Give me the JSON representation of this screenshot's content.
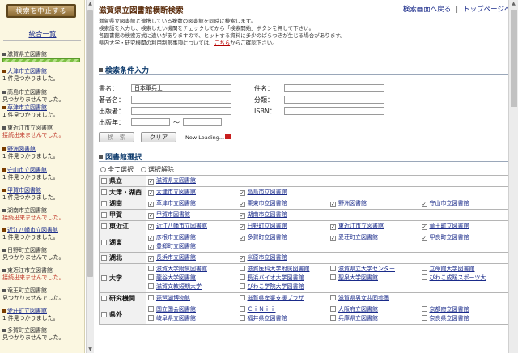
{
  "left": {
    "stop_button": "検索を中止する",
    "title": "統合一覧",
    "libraries": [
      {
        "name": "滋賀県立図書館",
        "result": "",
        "link": false
      },
      {
        "name": "大津市立図書館",
        "result": "1 件見つかりました。",
        "link": true
      },
      {
        "name": "高島市立図書館",
        "result": "見つかりませんでした。",
        "link": false
      },
      {
        "name": "草津市立図書館",
        "result": "1 件見つかりました。",
        "link": true
      },
      {
        "name": "東近江市立図書館",
        "result": "接続出来ませんでした。",
        "link": false,
        "err": true
      },
      {
        "name": "野洲図書館",
        "result": "1 件見つかりました。",
        "link": true
      },
      {
        "name": "守山市立図書館",
        "result": "1 件見つかりました。",
        "link": true
      },
      {
        "name": "甲賀市図書館",
        "result": "1 件見つかりました。",
        "link": true
      },
      {
        "name": "湖南市立図書館",
        "result": "接続出来ませんでした。",
        "link": false,
        "err": true
      },
      {
        "name": "近江八幡市立図書館",
        "result": "1 件見つかりました。",
        "link": true
      },
      {
        "name": "日野町立図書館",
        "result": "見つかりませんでした。",
        "link": false
      },
      {
        "name": "東近江市立図書館",
        "result": "接続出来ませんでした。",
        "link": false,
        "err": true
      },
      {
        "name": "竜王町立図書館",
        "result": "見つかりませんでした。",
        "link": false
      },
      {
        "name": "愛荘町立図書館",
        "result": "1 件見つかりました。",
        "link": true
      },
      {
        "name": "多賀町立図書館",
        "result": "見つかりませんでした。",
        "link": false
      }
    ]
  },
  "header": {
    "title": "滋賀県立図書館横断検索",
    "link_back": "検索画面へ戻る",
    "sep": "|",
    "link_top": "トップページへ戻"
  },
  "desc": [
    "滋賀県立図書館と連携している複数の図書館を同時に検索します。",
    "検索語を入力し、検索したい機関をチェックしてから「検索開始」ボタンを押して下さい。",
    "各図書館の検索方式に違いがありますので、ヒットする資料に多少のばらつきが生じる場合があります。"
  ],
  "desc4": {
    "before": "県内大学・研究機関の利用制限事項については、",
    "link": "こちら",
    "after": "からご確認下さい。"
  },
  "search": {
    "heading": "検索条件入力",
    "title_label": "書名：",
    "title_value": "日本軍兵士",
    "author_label": "著者名：",
    "publisher_label": "出版者：",
    "year_label": "出版年：",
    "tilde": "〜",
    "subject_label": "件名：",
    "class_label": "分類：",
    "isbn_label": "ISBN：",
    "search_btn": "検　索",
    "clear_btn": "クリア",
    "loading": "Now Loading..."
  },
  "libsel": {
    "heading": "図書館選択",
    "select_all": "全て選択",
    "deselect_all": "選択解除",
    "regions": [
      {
        "name": "県立",
        "checked": false,
        "items": [
          {
            "n": "滋賀県立図書館",
            "c": true
          }
        ]
      },
      {
        "name": "大津・湖西",
        "checked": false,
        "items": [
          {
            "n": "大津市立図書館",
            "c": true
          },
          {
            "n": "高島市立図書館",
            "c": true
          }
        ]
      },
      {
        "name": "湖南",
        "checked": false,
        "items": [
          {
            "n": "草津市立図書館",
            "c": true
          },
          {
            "n": "栗東市立図書館",
            "c": true
          },
          {
            "n": "野洲図書館",
            "c": true
          },
          {
            "n": "守山市立図書館",
            "c": true
          }
        ]
      },
      {
        "name": "甲賀",
        "checked": false,
        "items": [
          {
            "n": "甲賀市図書館",
            "c": true
          },
          {
            "n": "湖南市立図書館",
            "c": true
          }
        ]
      },
      {
        "name": "東近江",
        "checked": false,
        "items": [
          {
            "n": "近江八幡市立図書館",
            "c": true
          },
          {
            "n": "日野町立図書館",
            "c": true
          },
          {
            "n": "東近江市立図書館",
            "c": true
          },
          {
            "n": "竜王町立図書館",
            "c": true
          }
        ]
      },
      {
        "name": "湖東",
        "checked": false,
        "items": [
          {
            "n": "彦根市立図書館",
            "c": true
          },
          {
            "n": "多賀町立図書館",
            "c": true
          },
          {
            "n": "愛荘町立図書館",
            "c": true
          },
          {
            "n": "甲良町立図書館",
            "c": true
          },
          {
            "n": "豊郷町立図書館",
            "c": true
          }
        ]
      },
      {
        "name": "湖北",
        "checked": false,
        "items": [
          {
            "n": "長浜市立図書館",
            "c": true
          },
          {
            "n": "米原市立図書館",
            "c": true
          }
        ]
      },
      {
        "name": "大学",
        "checked": false,
        "items": [
          {
            "n": "滋賀大学附属図書館",
            "c": false
          },
          {
            "n": "滋賀医科大学附属図書館",
            "c": false
          },
          {
            "n": "滋賀県立大学センター",
            "c": false
          },
          {
            "n": "立命館大学図書館",
            "c": false
          },
          {
            "n": "龍谷大学図書館",
            "c": false
          },
          {
            "n": "長浜バイオ大学図書館",
            "c": false
          },
          {
            "n": "聖泉大学図書館",
            "c": false
          },
          {
            "n": "びわこ成蹊スポーツ大",
            "c": false
          },
          {
            "n": "滋賀文教短期大学",
            "c": false
          },
          {
            "n": "びわこ学院大学図書館",
            "c": false
          }
        ]
      },
      {
        "name": "研究機関",
        "checked": false,
        "items": [
          {
            "n": "琵琶湖博物館",
            "c": false
          },
          {
            "n": "滋賀県産業支援プラザ",
            "c": false
          },
          {
            "n": "滋賀県男女共同参画",
            "c": false
          }
        ]
      },
      {
        "name": "県外",
        "checked": false,
        "items": [
          {
            "n": "国立国会図書館",
            "c": false
          },
          {
            "n": "ＣｉＮｉｉ",
            "c": false
          },
          {
            "n": "大阪府立図書館",
            "c": false
          },
          {
            "n": "京都府立図書館",
            "c": false
          },
          {
            "n": "岐阜県立図書館",
            "c": false
          },
          {
            "n": "福井県立図書館",
            "c": false
          },
          {
            "n": "兵庫県立図書館",
            "c": false
          },
          {
            "n": "奈良県立図書館",
            "c": false
          }
        ]
      }
    ]
  }
}
